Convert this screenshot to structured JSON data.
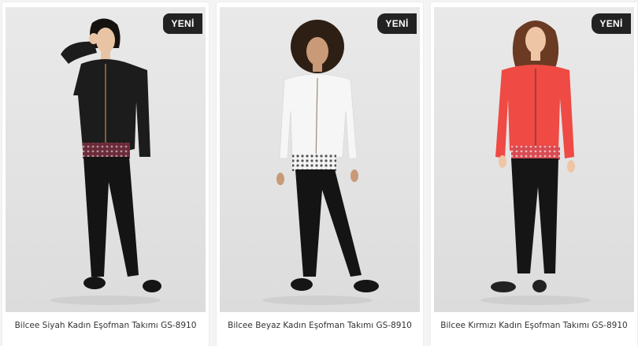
{
  "products": [
    {
      "badge": "YENİ",
      "name": "Bilcee Siyah Kadın Eşofman Takımı GS-8910",
      "jacket_color": "#1c1c1c",
      "pants_color": "#141414",
      "skin_color": "#e9c4a4",
      "hair_color": "#161210"
    },
    {
      "badge": "YENİ",
      "name": "Bilcee Beyaz Kadın Eşofman Takımı GS-8910",
      "jacket_color": "#f6f6f6",
      "pants_color": "#141414",
      "skin_color": "#c99a78",
      "hair_color": "#2e1f14"
    },
    {
      "badge": "YENİ",
      "name": "Bilcee Kırmızı Kadın Eşofman Takımı GS-8910",
      "jacket_color": "#ef4a44",
      "pants_color": "#151515",
      "skin_color": "#eec6a6",
      "hair_color": "#6b3a22"
    }
  ]
}
